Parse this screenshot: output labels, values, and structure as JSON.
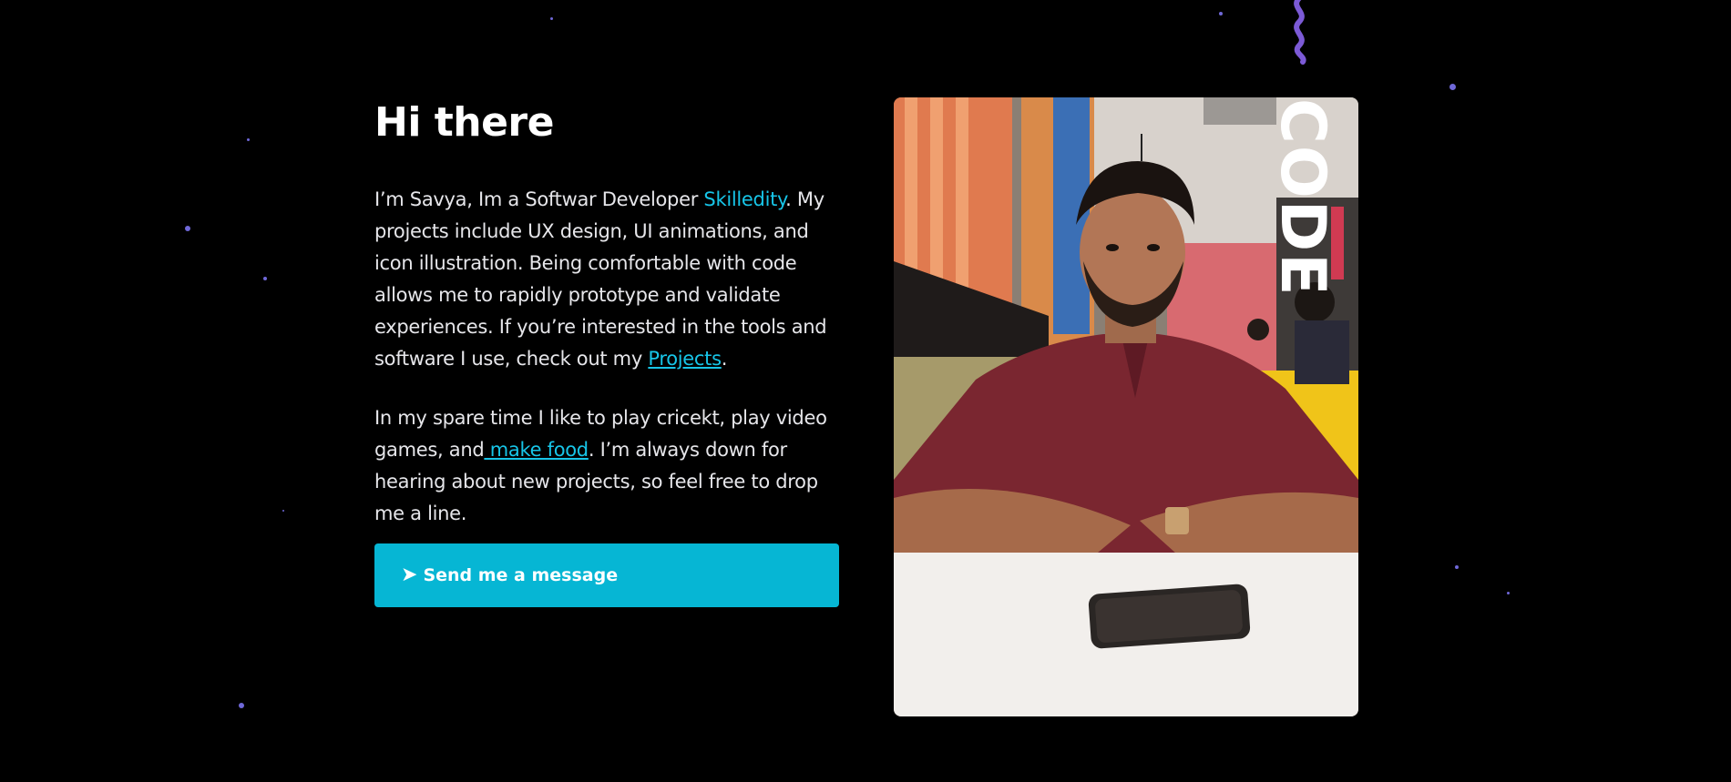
{
  "hero": {
    "title": "Hi there",
    "para1": {
      "before_company": "I’m Savya, Im a Softwar Developer ",
      "company_link": "Skilledity",
      "after_company": ". My projects include UX design, UI animations, and icon illustration. Being comfortable with code allows me to rapidly prototype and validate experiences. If you’re interested in the tools and software I use, check out my ",
      "projects_link": "Projects",
      "end": "."
    },
    "para2": {
      "before_link": "In my spare time I like to play cricekt, play video games, and",
      "food_link": " make food",
      "after_link": ". I’m always down for hearing about new projects, so feel free to drop me a line."
    }
  },
  "cta": {
    "icon": "➤",
    "label": "Send me a message"
  },
  "photo": {
    "overlay_text": "CODE"
  },
  "colors": {
    "background": "#000000",
    "accent": "#06b6d4",
    "link": "#17c5e8",
    "star": "#6f68d8",
    "squiggle": "#7c5ad6"
  }
}
